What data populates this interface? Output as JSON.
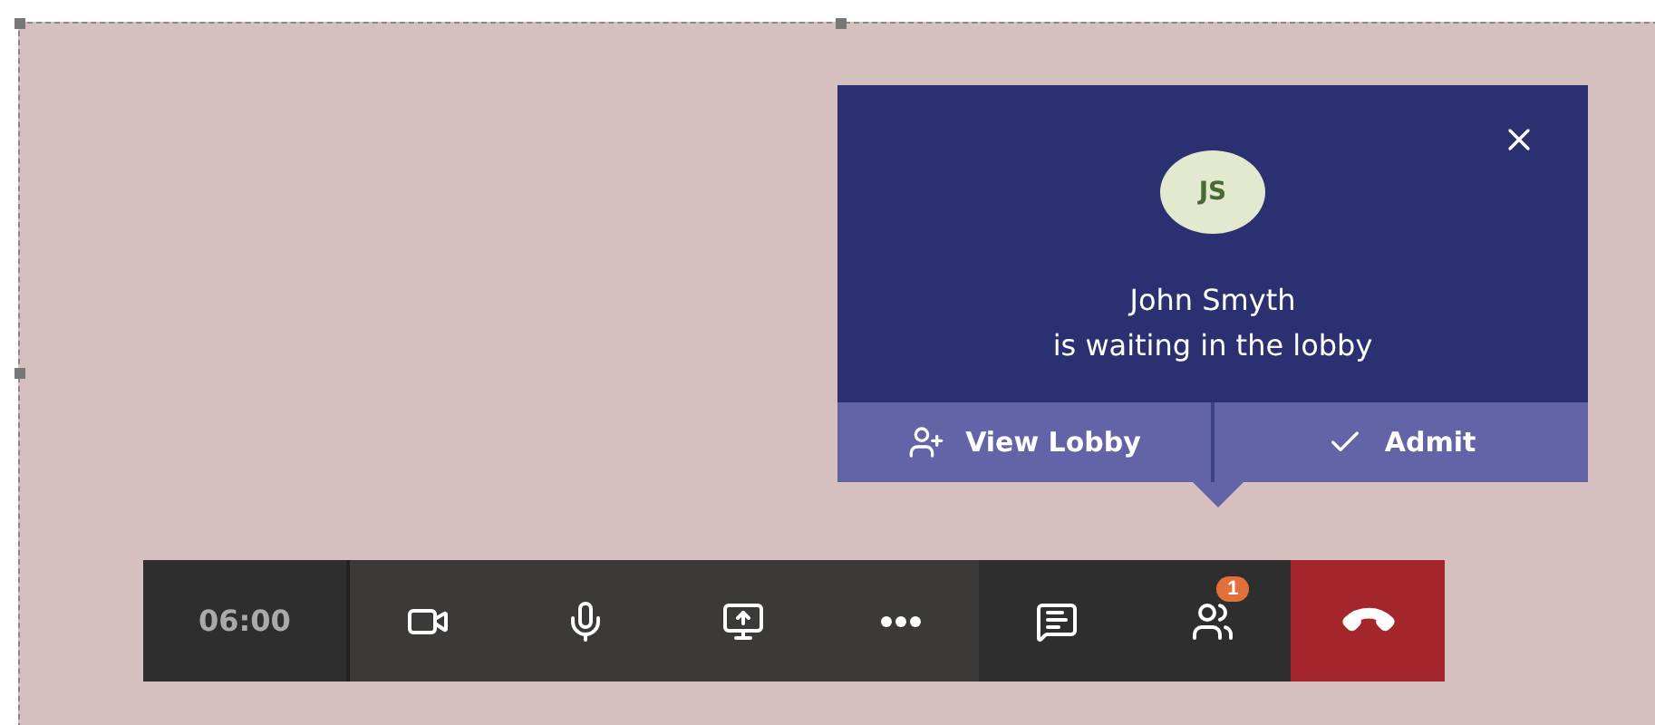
{
  "lobby_notification": {
    "initials": "JS",
    "name": "John Smyth",
    "message": "is waiting in the lobby",
    "actions": [
      {
        "kind": "view_lobby",
        "label": "View Lobby"
      },
      {
        "kind": "admit",
        "label": "Admit"
      }
    ]
  },
  "call_toolbar": {
    "timer": "06:00",
    "buttons": [
      {
        "kind": "camera"
      },
      {
        "kind": "microphone"
      },
      {
        "kind": "share"
      },
      {
        "kind": "more"
      },
      {
        "kind": "chat"
      },
      {
        "kind": "participants",
        "badge": "1"
      },
      {
        "kind": "hangup"
      }
    ]
  }
}
